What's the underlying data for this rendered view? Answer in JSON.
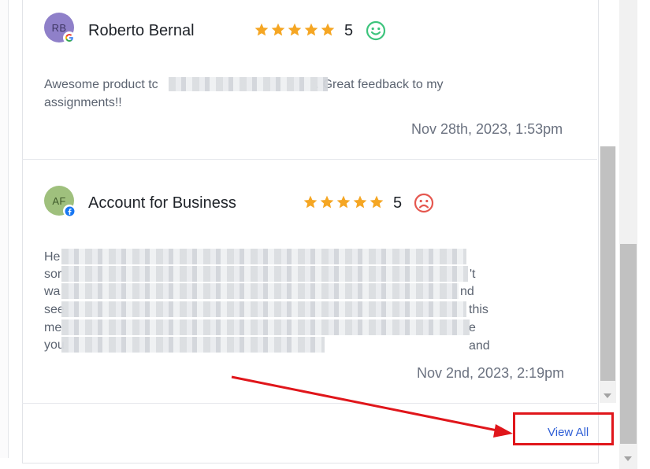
{
  "reviews": [
    {
      "initials": "RB",
      "source_icon": "google-icon",
      "name": "Roberto Bernal",
      "rating": 5,
      "rating_label": "5",
      "sentiment_icon": "smiley-face-icon",
      "text_start": "Awesome product tc",
      "text_end": ". Great feedback to my",
      "text_line2": "assignments!!",
      "date": "Nov 28th, 2023, 1:53pm"
    },
    {
      "initials": "AF",
      "source_icon": "facebook-icon",
      "name": "Account for Business",
      "rating": 5,
      "rating_label": "5",
      "sentiment_icon": "sad-face-icon",
      "lines": [
        {
          "start": "He",
          "end": ""
        },
        {
          "start": "sor",
          "end": "'t"
        },
        {
          "start": "wa",
          "end": "nd"
        },
        {
          "start": "see",
          "end": "this"
        },
        {
          "start": "me",
          "end": "e and"
        },
        {
          "start": "you",
          "end": ""
        }
      ],
      "date": "Nov 2nd, 2023, 2:19pm"
    }
  ],
  "footer": {
    "view_all_label": "View All"
  },
  "colors": {
    "star": "#f5a623",
    "happy": "#3cc47c",
    "sad": "#e5574f",
    "link": "#2f5fd6",
    "highlight": "#e0161b"
  }
}
